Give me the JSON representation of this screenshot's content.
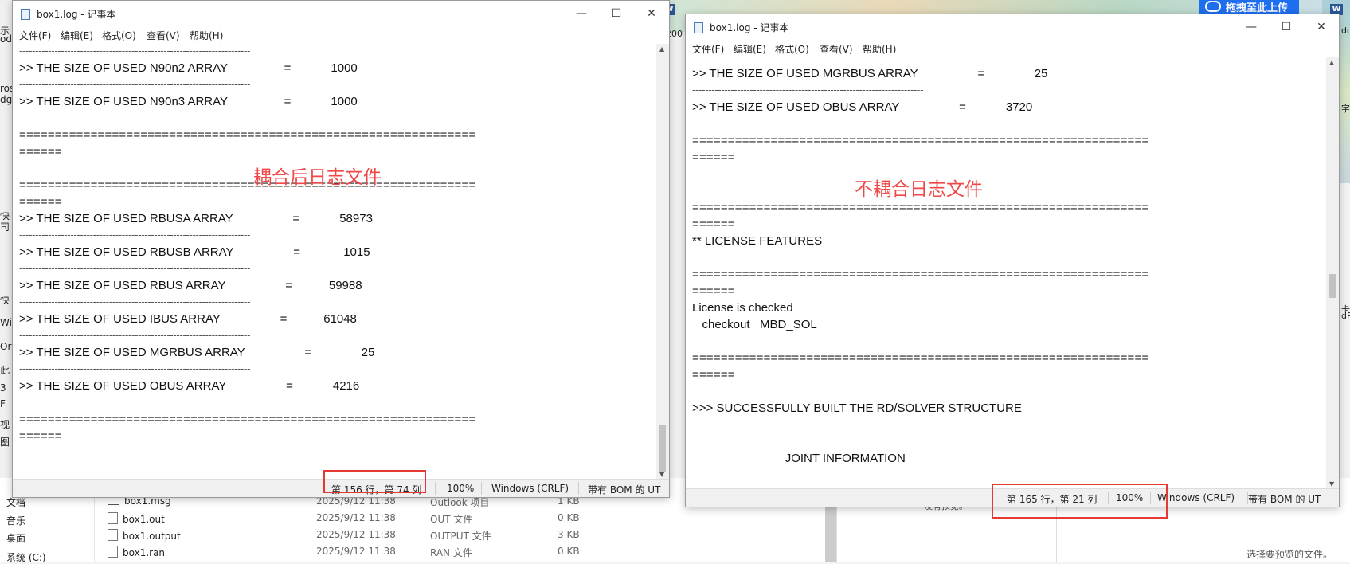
{
  "background": {
    "upload_button": "拖拽至此上传",
    "word_badge": "W",
    "left_fragments": [
      "示",
      "od",
      "ros",
      "dg",
      "快",
      "司",
      "快",
      "Wi",
      "Or",
      "此",
      "3",
      "F",
      "视",
      "图",
      "文档",
      "音乐",
      "桌面",
      "系统 (C:)"
    ],
    "right_fragments": [
      "do",
      "字",
      "卡",
      "dP"
    ],
    "frag_200": "200",
    "preview_text": "没有预览。",
    "preview_right": "选择要预览的文件。",
    "files": [
      {
        "name": "box1.msg",
        "date": "2025/9/12 11:38",
        "type": "Outlook 项目",
        "size": "1 KB",
        "icon": "mail-icon"
      },
      {
        "name": "box1.out",
        "date": "2025/9/12 11:38",
        "type": "OUT 文件",
        "size": "0 KB",
        "icon": "file-icon"
      },
      {
        "name": "box1.output",
        "date": "2025/9/12 11:38",
        "type": "OUTPUT 文件",
        "size": "3 KB",
        "icon": "file-icon"
      },
      {
        "name": "box1.ran",
        "date": "2025/9/12 11:38",
        "type": "RAN 文件",
        "size": "0 KB",
        "icon": "file-icon"
      }
    ]
  },
  "left_window": {
    "title": "box1.log - 记事本",
    "controls": {
      "minimize": "—",
      "maximize": "☐",
      "close": "✕"
    },
    "menu": [
      "文件(F)",
      "编辑(E)",
      "格式(O)",
      "查看(V)",
      "帮助(H)"
    ],
    "lines": [
      {
        "kind": "dash",
        "text": "------------------------------------------------------------------------"
      },
      {
        "kind": "text",
        "text": ">> THE SIZE OF USED N90n2 ARRAY                 =            1000"
      },
      {
        "kind": "dash",
        "text": "------------------------------------------------------------------------"
      },
      {
        "kind": "text",
        "text": ">> THE SIZE OF USED N90n3 ARRAY                 =            1000"
      },
      {
        "kind": "blank",
        "text": ""
      },
      {
        "kind": "eq",
        "text": "================================================================"
      },
      {
        "kind": "eq",
        "text": "======"
      },
      {
        "kind": "blank",
        "text": ""
      },
      {
        "kind": "eq",
        "text": "================================================================"
      },
      {
        "kind": "eq",
        "text": "======"
      },
      {
        "kind": "text",
        "text": ">> THE SIZE OF USED RBUSA ARRAY                  =            58973"
      },
      {
        "kind": "dash",
        "text": "------------------------------------------------------------------------"
      },
      {
        "kind": "text",
        "text": ">> THE SIZE OF USED RBUSB ARRAY                  =             1015"
      },
      {
        "kind": "dash",
        "text": "------------------------------------------------------------------------"
      },
      {
        "kind": "text",
        "text": ">> THE SIZE OF USED RBUS ARRAY                  =           59988"
      },
      {
        "kind": "dash",
        "text": "------------------------------------------------------------------------"
      },
      {
        "kind": "text",
        "text": ">> THE SIZE OF USED IBUS ARRAY                  =           61048"
      },
      {
        "kind": "dash",
        "text": "------------------------------------------------------------------------"
      },
      {
        "kind": "text",
        "text": ">> THE SIZE OF USED MGRBUS ARRAY                  =               25"
      },
      {
        "kind": "dash",
        "text": "------------------------------------------------------------------------"
      },
      {
        "kind": "text",
        "text": ">> THE SIZE OF USED OBUS ARRAY                  =            4216"
      },
      {
        "kind": "blank",
        "text": ""
      },
      {
        "kind": "eq",
        "text": "================================================================"
      },
      {
        "kind": "eq",
        "text": "======"
      }
    ],
    "annotation": "耦合后日志文件",
    "status": {
      "position": "第 156 行，第 74 列",
      "zoom": "100%",
      "eol": "Windows (CRLF)",
      "encoding": "带有 BOM 的 UT"
    }
  },
  "right_window": {
    "title": "box1.log - 记事本",
    "controls": {
      "minimize": "—",
      "maximize": "☐",
      "close": "✕"
    },
    "menu": [
      "文件(F)",
      "编辑(E)",
      "格式(O)",
      "查看(V)",
      "帮助(H)"
    ],
    "lines": [
      {
        "kind": "text",
        "text": ">> THE SIZE OF USED MGRBUS ARRAY                  =               25"
      },
      {
        "kind": "dash",
        "text": "------------------------------------------------------------------------"
      },
      {
        "kind": "text",
        "text": ">> THE SIZE OF USED OBUS ARRAY                  =            3720"
      },
      {
        "kind": "blank",
        "text": ""
      },
      {
        "kind": "eq",
        "text": "================================================================"
      },
      {
        "kind": "eq",
        "text": "======"
      },
      {
        "kind": "blank",
        "text": ""
      },
      {
        "kind": "blank",
        "text": ""
      },
      {
        "kind": "eq",
        "text": "================================================================"
      },
      {
        "kind": "eq",
        "text": "======"
      },
      {
        "kind": "text",
        "text": "** LICENSE FEATURES"
      },
      {
        "kind": "blank",
        "text": ""
      },
      {
        "kind": "eq",
        "text": "================================================================"
      },
      {
        "kind": "eq",
        "text": "======"
      },
      {
        "kind": "text",
        "text": "License is checked"
      },
      {
        "kind": "text",
        "text": "   checkout   MBD_SOL"
      },
      {
        "kind": "blank",
        "text": ""
      },
      {
        "kind": "eq",
        "text": "================================================================"
      },
      {
        "kind": "eq",
        "text": "======"
      },
      {
        "kind": "blank",
        "text": ""
      },
      {
        "kind": "text",
        "text": ">>> SUCCESSFULLY BUILT THE RD/SOLVER STRUCTURE"
      },
      {
        "kind": "blank",
        "text": ""
      },
      {
        "kind": "blank",
        "text": ""
      },
      {
        "kind": "text",
        "text": "                            JOINT INFORMATION"
      },
      {
        "kind": "blank",
        "text": ""
      },
      {
        "kind": "eq",
        "text": "================================================================"
      }
    ],
    "annotation": "不耦合日志文件",
    "status": {
      "position": "第 165 行，第 21 列",
      "zoom": "100%",
      "eol": "Windows (CRLF)",
      "encoding": "带有 BOM 的 UT"
    }
  }
}
